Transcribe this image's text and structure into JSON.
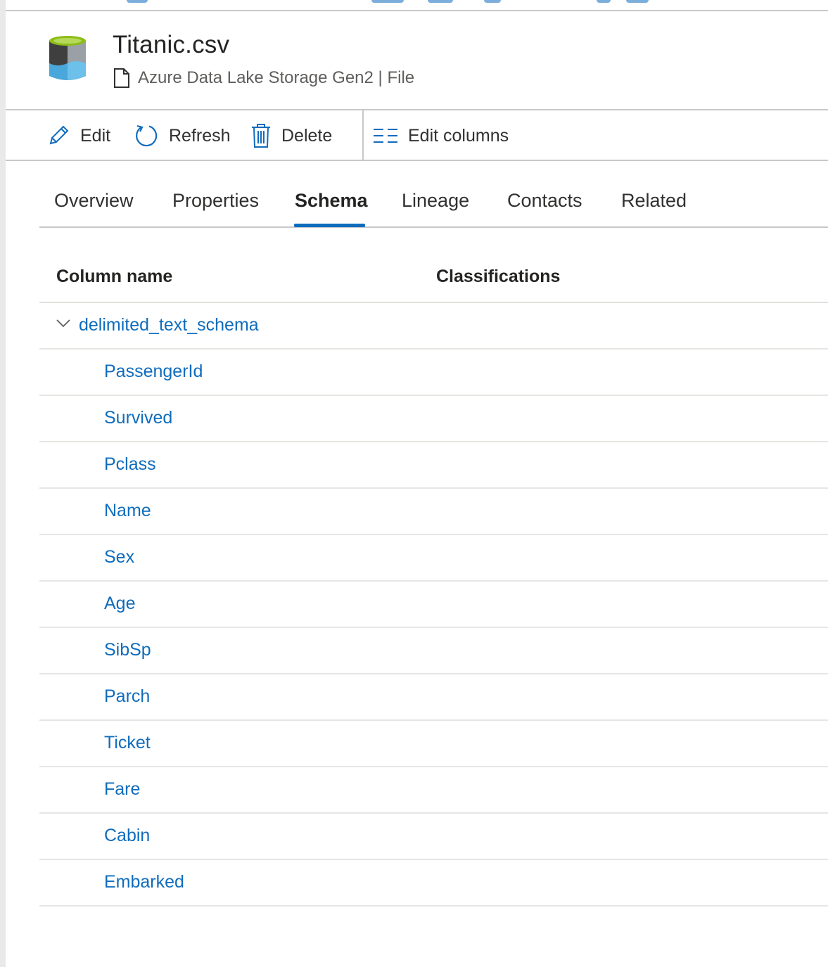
{
  "asset": {
    "title": "Titanic.csv",
    "subtitle": "Azure Data Lake Storage Gen2 | File"
  },
  "toolbar": {
    "edit_label": "Edit",
    "refresh_label": "Refresh",
    "delete_label": "Delete",
    "edit_columns_label": "Edit columns"
  },
  "tabs": [
    {
      "label": "Overview"
    },
    {
      "label": "Properties"
    },
    {
      "label": "Schema",
      "active": true
    },
    {
      "label": "Lineage"
    },
    {
      "label": "Contacts"
    },
    {
      "label": "Related"
    }
  ],
  "schema": {
    "headers": {
      "column_name": "Column name",
      "classifications": "Classifications"
    },
    "group": "delimited_text_schema",
    "columns": [
      "PassengerId",
      "Survived",
      "Pclass",
      "Name",
      "Sex",
      "Age",
      "SibSp",
      "Parch",
      "Ticket",
      "Fare",
      "Cabin",
      "Embarked"
    ]
  },
  "colors": {
    "accent": "#0f6cbd",
    "text": "#323130",
    "border": "#c8c8c8",
    "icon_green": "#8cbd18",
    "icon_blue": "#4aa7dc",
    "icon_gray": "#5a5a5a"
  },
  "icons": {
    "asset": "data-lake-file-icon",
    "subtitle": "document-icon",
    "edit": "pencil-icon",
    "refresh": "refresh-icon",
    "delete": "trash-icon",
    "edit_columns": "columns-icon",
    "expand": "chevron-down-icon"
  }
}
